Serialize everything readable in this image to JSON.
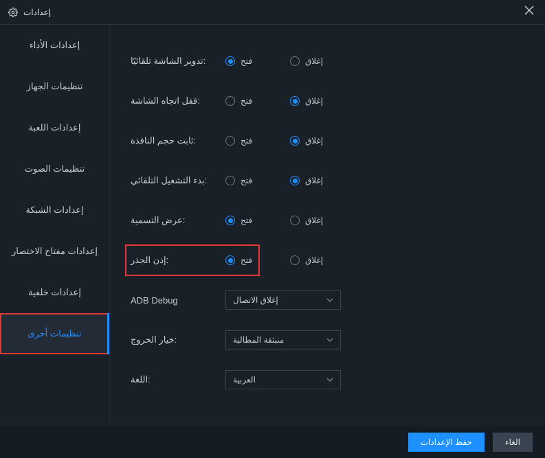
{
  "window": {
    "title": "إعدادات"
  },
  "sidebar": {
    "items": [
      {
        "label": "إعدادات الأداء"
      },
      {
        "label": "تنظيمات الجهاز"
      },
      {
        "label": "إعدادات اللعبة"
      },
      {
        "label": "تنظيمات الصوت"
      },
      {
        "label": "إعدادات الشبكة"
      },
      {
        "label": "إعدادات مفتاح الاختصار"
      },
      {
        "label": "إعدادات خلفية"
      },
      {
        "label": "تنظيمات أخرى"
      }
    ]
  },
  "radios": {
    "open": "فتح",
    "close": "إغلاق"
  },
  "rows": {
    "autorotate": {
      "label": "تدوير الشاشة تلقائيًا:",
      "value": "open"
    },
    "lock_orientation": {
      "label": "قفل اتجاه الشاشة:",
      "value": "close"
    },
    "fixed_window": {
      "label": "ثابت حجم النافذة:",
      "value": "close"
    },
    "autostart": {
      "label": "بدء التشغيل التلقائي:",
      "value": "close"
    },
    "show_label": {
      "label": "عرض التسمية:",
      "value": "open"
    },
    "root_permission": {
      "label": "إذن الجذر:",
      "value": "open"
    }
  },
  "selects": {
    "adb": {
      "label": "ADB Debug",
      "value": "إغلاق الاتصال"
    },
    "exit": {
      "label": "خيار الخروج:",
      "value": "منبثقة المطالبة"
    },
    "language": {
      "label": "اللغة:",
      "value": "العربية"
    }
  },
  "buttons": {
    "save": "حفظ الإعدادات",
    "cancel": "الغاء"
  }
}
